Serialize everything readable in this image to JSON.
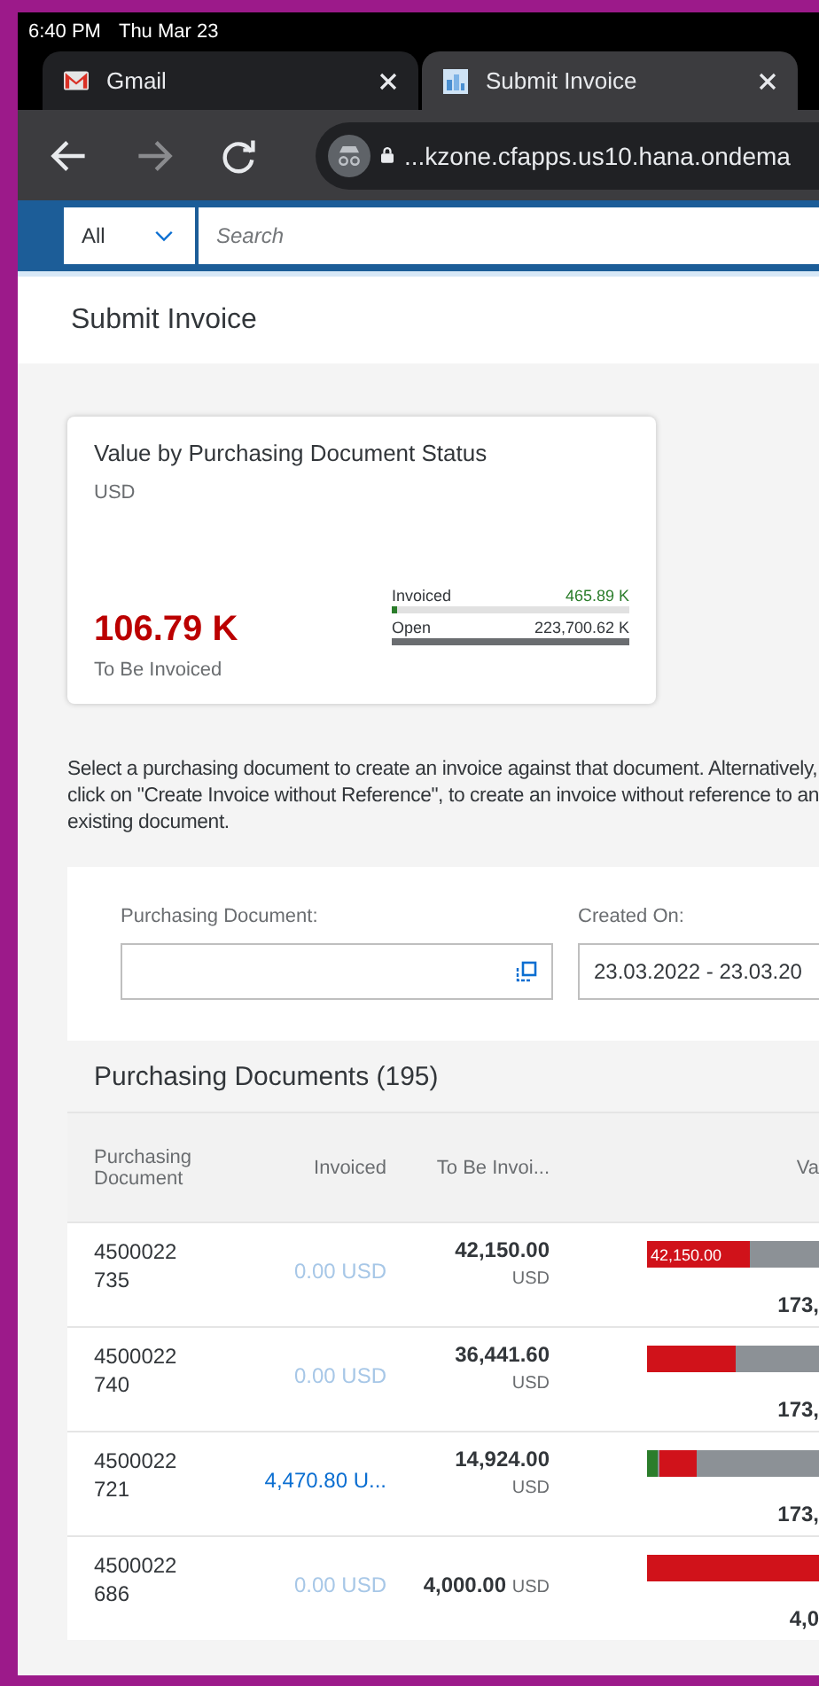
{
  "status_bar": {
    "time": "6:40 PM",
    "date": "Thu Mar 23"
  },
  "browser_tabs": [
    {
      "title": "Gmail",
      "kind": "mail",
      "selected": false
    },
    {
      "title": "Submit Invoice",
      "kind": "app",
      "selected": true
    }
  ],
  "address_bar": {
    "url": "...kzone.cfapps.us10.hana.ondema"
  },
  "shell_search": {
    "scope": "All",
    "placeholder": "Search"
  },
  "page": {
    "title": "Submit Invoice"
  },
  "kpi_card": {
    "title": "Value by Purchasing Document Status",
    "unit": "USD",
    "value": "106.79 K",
    "value_label": "To Be Invoiced",
    "bars": [
      {
        "label": "Invoiced",
        "value": "465.89 K",
        "kind": "invoiced",
        "level": 0.01
      },
      {
        "label": "Open",
        "value": "223,700.62 K",
        "kind": "open",
        "level": 1
      }
    ]
  },
  "instructions": "Select a purchasing document to create an invoice against that document. Alternatively, click on \"Create Invoice without Reference\", to create an invoice without reference to an existing document.",
  "filters": [
    {
      "label": "Purchasing Document:",
      "kind": "valuehelp"
    },
    {
      "label": "Created On:",
      "value": "23.03.2022 - 23.03.20",
      "kind": "date"
    }
  ],
  "table": {
    "title": "Purchasing Documents (195)",
    "columns": [
      "Purchasing Document",
      "Invoiced",
      "To Be Invoi...",
      "Va"
    ],
    "rows": [
      {
        "document": "4500022735",
        "invoiced": "0.00 USD",
        "invoiced_zero": true,
        "to_be_invoiced": "42,150.00",
        "currency": "USD",
        "inline_currency": false,
        "bar_label": "42,150.00",
        "segments": [
          {
            "kind": "open",
            "level": 0.6
          }
        ],
        "total": "173,"
      },
      {
        "document": "4500022740",
        "invoiced": "0.00 USD",
        "invoiced_zero": true,
        "to_be_invoiced": "36,441.60",
        "currency": "USD",
        "inline_currency": false,
        "segments": [
          {
            "kind": "open",
            "level": 0.52
          }
        ],
        "total": "173,"
      },
      {
        "document": "4500022721",
        "invoiced": "4,470.80 U...",
        "invoiced_zero": false,
        "to_be_invoiced": "14,924.00",
        "currency": "USD",
        "inline_currency": false,
        "segments": [
          {
            "kind": "invoiced",
            "level": 0.06
          },
          {
            "kind": "open",
            "level": 0.22
          }
        ],
        "total": "173,"
      },
      {
        "document": "4500022686",
        "invoiced": "0.00 USD",
        "invoiced_zero": true,
        "to_be_invoiced": "4,000.00",
        "currency": "USD",
        "inline_currency": true,
        "segments": [
          {
            "kind": "open",
            "level": 1
          }
        ],
        "total": "4,0"
      }
    ]
  }
}
